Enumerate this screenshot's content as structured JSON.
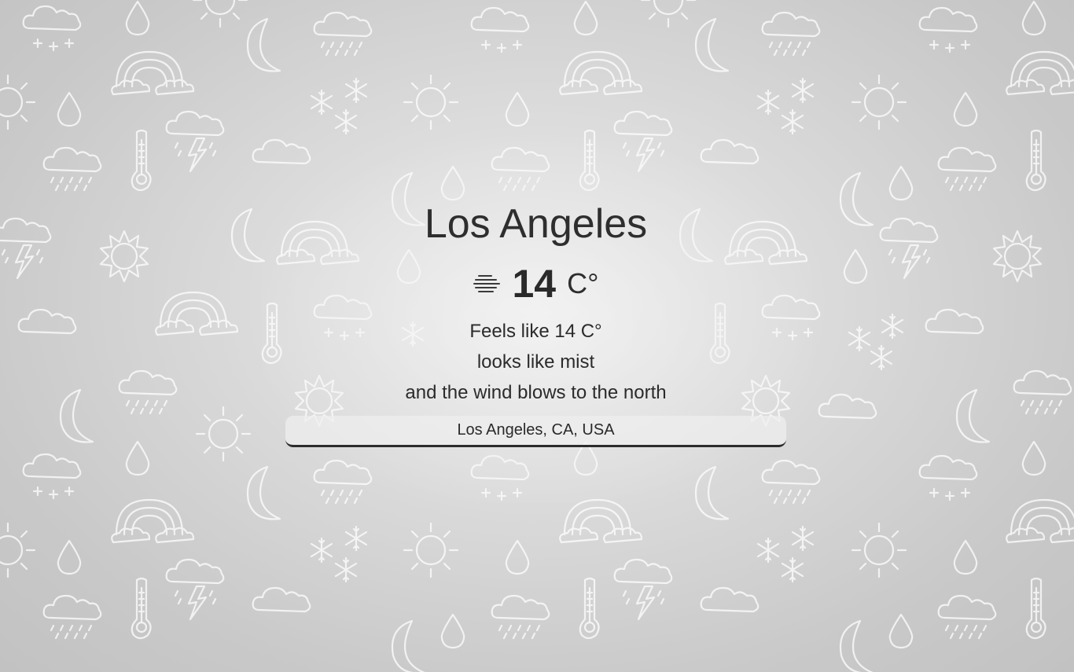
{
  "weather": {
    "city": "Los Angeles",
    "icon": "mist-icon",
    "temperature": "14",
    "unit": "C°",
    "feels_like": "Feels like 14 C°",
    "condition": "looks like mist",
    "wind": "and the wind blows to the north"
  },
  "location_field": {
    "value": "Los Angeles, CA, USA"
  },
  "background": {
    "pattern": "weather-doodle-pattern",
    "doodle_icons": [
      "cloud-icon",
      "snow-cloud-icon",
      "raindrop-icon",
      "sun-icon",
      "moon-icon",
      "rainbow-icon",
      "thermometer-icon",
      "storm-cloud-icon",
      "rain-cloud-icon",
      "snowflake-icon"
    ],
    "colors": {
      "base": "#c9c9c9",
      "center": "#ececec",
      "doodle": "#ffffff"
    }
  }
}
